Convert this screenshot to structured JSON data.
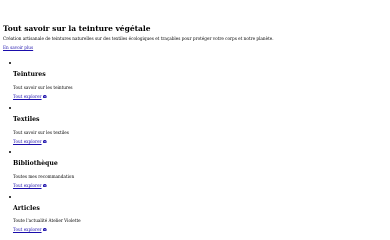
{
  "page": {
    "title": "Tout savoir sur la teinture végétale",
    "intro": "Création artisanale de teintures naturelles sur des textiles écologiques et traçables pour protéger votre corps et notre planète.",
    "more_link": "En savoir plus"
  },
  "cards": [
    {
      "title": "Teintures",
      "description": "Tout savoir sur les teintures",
      "link": "Tout explorer"
    },
    {
      "title": "Textiles",
      "description": "Tout savoir sur les textiles",
      "link": "Tout explorer"
    },
    {
      "title": "Bibliothèque",
      "description": "Toutes mes recommandation",
      "link": "Tout explorer"
    },
    {
      "title": "Articles",
      "description": "Toute l'actualité Atelier Violette",
      "link": "Tout explorer"
    }
  ],
  "colors": {
    "link": "#1a0dab",
    "icon": "#1a0dab"
  },
  "icons": {
    "card_link": "arrow-right-circle-icon"
  }
}
